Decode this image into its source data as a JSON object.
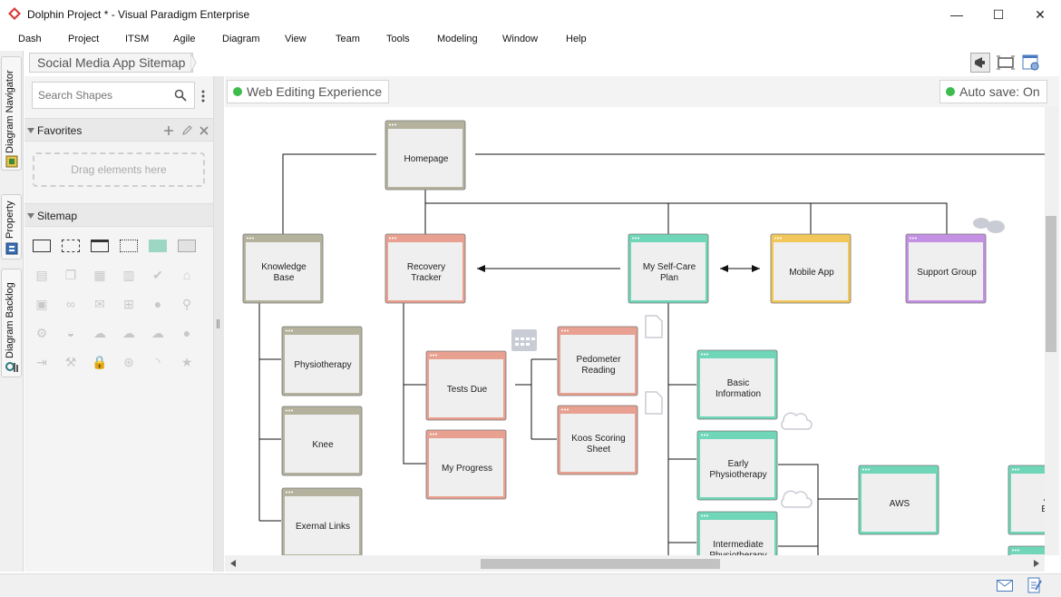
{
  "window": {
    "title": "Dolphin Project * - Visual Paradigm Enterprise",
    "controls": [
      "—",
      "☐",
      "✕"
    ]
  },
  "menu": [
    "Dash",
    "Project",
    "ITSM",
    "Agile",
    "Diagram",
    "View",
    "Team",
    "Tools",
    "Modeling",
    "Window",
    "Help"
  ],
  "left_tabs": [
    "Diagram Navigator",
    "Property",
    "Diagram Backlog"
  ],
  "breadcrumb": "Social Media App Sitemap",
  "palette": {
    "search_placeholder": "Search Shapes",
    "favorites_title": "Favorites",
    "drop_hint": "Drag elements here",
    "sitemap_title": "Sitemap",
    "shape_icons": [
      "page-outline-icon",
      "page-dashed-icon",
      "page-header-icon",
      "page-dotted-icon",
      "folder-icon",
      "panel-icon",
      "document-icon",
      "documents-icon",
      "calendar-icon",
      "chart-icon",
      "check-icon",
      "home-icon",
      "image-icon",
      "link-icon",
      "mail-icon",
      "hierarchy-icon",
      "user-icon",
      "search-icon",
      "gears-icon",
      "basket-icon",
      "cloud-icon",
      "cloud-download-icon",
      "cloud-upload-icon",
      "chat-icon",
      "login-icon",
      "wrench-icon",
      "lock-icon",
      "film-icon",
      "rss-icon",
      "star-icon"
    ]
  },
  "canvas": {
    "experience_label": "Web Editing Experience",
    "autosave_label": "Auto save: On"
  },
  "colors": {
    "gray": "#b4b29c",
    "salmon": "#e8a090",
    "teal": "#6fd6b8",
    "yellow": "#f1c75a",
    "purple": "#c390e4"
  },
  "nodes": {
    "homepage": "Homepage",
    "knowledge_base": [
      "Knowledge",
      "Base"
    ],
    "recovery_tracker": [
      "Recovery",
      "Tracker"
    ],
    "self_care": [
      "My Self-Care",
      "Plan"
    ],
    "mobile_app": "Mobile App",
    "support_group": "Support Group",
    "physiotherapy": "Physiotherapy",
    "knee": "Knee",
    "external_links": "Exernal Links",
    "tests_due": "Tests Due",
    "my_progress": "My Progress",
    "pedometer": [
      "Pedometer",
      "Reading"
    ],
    "koos": [
      "Koos Scoring",
      "Sheet"
    ],
    "basic_info": [
      "Basic",
      "Information"
    ],
    "early_physio": [
      "Early",
      "Physiotherapy"
    ],
    "intermediate_physio": [
      "Intermediate",
      "Physiotherapy"
    ],
    "aws": "AWS",
    "cut_right": [
      "Ae",
      "Exe"
    ]
  }
}
